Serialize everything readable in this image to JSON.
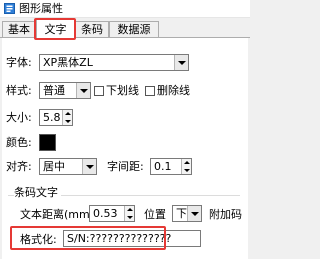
{
  "window": {
    "title": "图形属性",
    "icon": "properties-icon"
  },
  "tabs": [
    {
      "label": "基本"
    },
    {
      "label": "文字"
    },
    {
      "label": "条码"
    },
    {
      "label": "数据源"
    }
  ],
  "font": {
    "label": "字体:",
    "value": "XP黑体ZL"
  },
  "style": {
    "label": "样式:",
    "value": "普通",
    "underline_label": "下划线",
    "underline_checked": false,
    "strikethrough_label": "删除线",
    "strikethrough_checked": false
  },
  "size": {
    "label": "大小:",
    "value": "5.8"
  },
  "color": {
    "label": "颜色:",
    "value": "#000000"
  },
  "align": {
    "label": "对齐:",
    "value": "居中"
  },
  "spacing": {
    "label": "字间距:",
    "value": "0.1"
  },
  "barcode_text": {
    "group_label": "条码文字",
    "distance_label": "文本距离(mm):",
    "distance_value": "0.53",
    "position_label": "位置",
    "position_value": "下",
    "extra_label": "附加码",
    "format_label": "格式化:",
    "format_value": "S/N:??????????????"
  }
}
